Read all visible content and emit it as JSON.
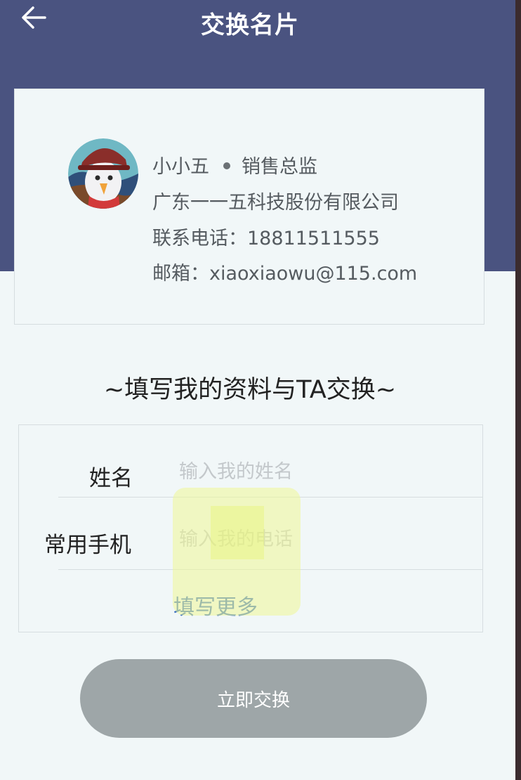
{
  "header": {
    "title": "交换名片",
    "back_icon": "arrow-left-icon"
  },
  "card": {
    "name": "小小五",
    "position": "销售总监",
    "company": "广东一一五科技股份有限公司",
    "phone_label": "联系电话：",
    "phone": "18811511555",
    "email_label": "邮箱：",
    "email": "xiaoxiaowu@115.com"
  },
  "form": {
    "heading": "~填写我的资料与TA交换~",
    "name_label": "姓名",
    "name_placeholder": "输入我的姓名",
    "name_value": "",
    "phone_label": "常用手机",
    "phone_placeholder": "输入我的电话",
    "phone_value": "",
    "more_link": "填写更多"
  },
  "submit": {
    "label": "立即交换"
  },
  "colors": {
    "header_bg": "#4a5380",
    "page_bg": "#f1f7f8",
    "link": "#3a6fc0",
    "button_disabled": "#9ea6a8"
  }
}
